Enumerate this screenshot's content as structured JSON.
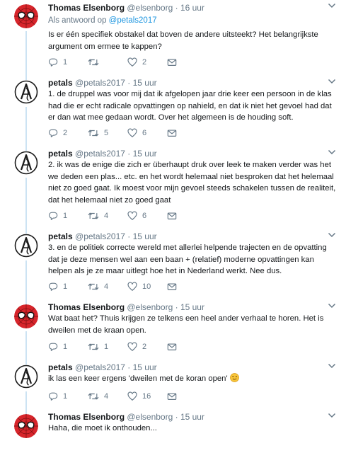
{
  "tweets": [
    {
      "name": "Thomas Elsenborg",
      "handle": "@elsenborg",
      "time": "16 uur",
      "reply_prefix": "Als antwoord op",
      "reply_handle": "@petals2017",
      "text": "Is er één specifiek obstakel dat boven de andere uitsteekt? Het belangrijkste argument om ermee te kappen?",
      "replies": "1",
      "retweets": "",
      "likes": "2"
    },
    {
      "name": "petals",
      "handle": "@petals2017",
      "time": "15 uur",
      "text": "1. de druppel was voor mij dat ik afgelopen jaar drie keer een persoon in de klas had die er echt radicale opvattingen op nahield, en dat ik niet het gevoel had dat er dan wat mee gedaan wordt. Over het algemeen is de houding soft.",
      "replies": "2",
      "retweets": "5",
      "likes": "6"
    },
    {
      "name": "petals",
      "handle": "@petals2017",
      "time": "15 uur",
      "text": "2. ik was de enige die zich er überhaupt druk over leek te maken verder was het we deden een plas... etc. en het wordt helemaal niet besproken dat het helemaal niet zo goed gaat. Ik moest voor mijn gevoel steeds schakelen tussen de realiteit, dat het helemaal niet zo goed gaat",
      "replies": "1",
      "retweets": "4",
      "likes": "6"
    },
    {
      "name": "petals",
      "handle": "@petals2017",
      "time": "15 uur",
      "text": "3. en de politiek correcte wereld met allerlei helpende trajecten en de opvatting dat je deze mensen wel aan een baan + (relatief) moderne opvattingen kan helpen als je ze maar uitlegt hoe het in Nederland werkt. Nee dus.",
      "replies": "1",
      "retweets": "4",
      "likes": "10"
    },
    {
      "name": "Thomas Elsenborg",
      "handle": "@elsenborg",
      "time": "15 uur",
      "text": "Wat baat het? Thuis krijgen ze telkens een heel ander verhaal te horen. Het is dweilen met de kraan open.",
      "replies": "1",
      "retweets": "1",
      "likes": "2"
    },
    {
      "name": "petals",
      "handle": "@petals2017",
      "time": "15 uur",
      "text": "ik las een keer ergens 'dweilen met de koran open'",
      "replies": "1",
      "retweets": "4",
      "likes": "16"
    },
    {
      "name": "Thomas Elsenborg",
      "handle": "@elsenborg",
      "time": "15 uur",
      "text": "Haha, die moet ik onthouden...",
      "replies": "",
      "retweets": "",
      "likes": ""
    }
  ],
  "dot": "·",
  "colors": {
    "text": "#14171a",
    "muted": "#657786",
    "link": "#1b95e0",
    "thread": "#cce3f3",
    "divider": "#e6ecf0"
  },
  "icons": {
    "reply": "reply-icon",
    "retweet": "retweet-icon",
    "like": "heart-icon",
    "dm": "envelope-icon",
    "caret": "chevron-down-icon",
    "avatar_thomas": "spiderman-avatar",
    "avatar_petals": "atheist-symbol-avatar",
    "emoji": "wink-emoji"
  }
}
